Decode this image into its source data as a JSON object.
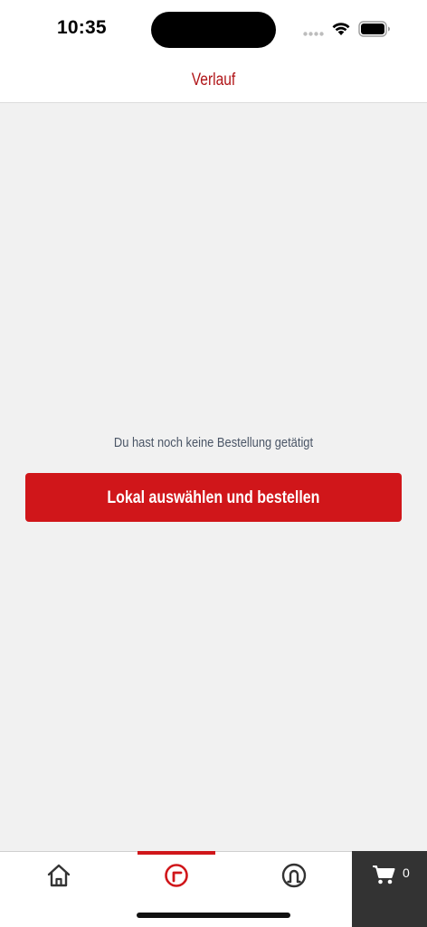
{
  "status_bar": {
    "time": "10:35"
  },
  "header": {
    "title": "Verlauf"
  },
  "main": {
    "empty_message": "Du hast noch keine Bestellung getätigt",
    "cta_label": "Lokal auswählen und bestellen"
  },
  "tab_bar": {
    "tabs": [
      {
        "icon": "home-icon",
        "active": false
      },
      {
        "icon": "history-icon",
        "active": true
      },
      {
        "icon": "account-icon",
        "active": false
      }
    ],
    "cart": {
      "icon": "cart-icon",
      "count": "0"
    }
  },
  "colors": {
    "accent": "#d0161a",
    "title": "#b01417",
    "cart_background": "#333333",
    "background": "#f1f1f1"
  }
}
